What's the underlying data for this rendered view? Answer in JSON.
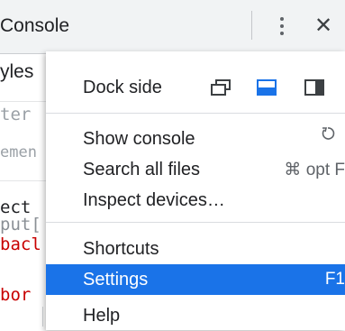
{
  "topbar": {
    "title": "Console",
    "close_glyph": "✕"
  },
  "left_panel": {
    "styles_tab": "yles",
    "filter_placeholder": "ter",
    "element_text": "emen",
    "selector_text": "ect",
    "input_text": "put[",
    "background_prop": "bacl",
    "border_prop": "bor"
  },
  "menu": {
    "dock_side_label": "Dock side",
    "dock_options": [
      "undock-into-separate-window-icon",
      "dock-to-bottom-icon",
      "dock-to-right-icon"
    ],
    "selected_dock": "dock-to-bottom",
    "show_console_label": "Show console",
    "show_console_icon": "refresh-icon",
    "search_all_files_label": "Search all files",
    "search_all_files_shortcut": "⌘ opt F",
    "inspect_devices_label": "Inspect devices…",
    "shortcuts_label": "Shortcuts",
    "settings_label": "Settings",
    "settings_shortcut": "F1",
    "help_label": "Help"
  },
  "colors": {
    "accent": "#1a73e8",
    "css_property": "#c80000"
  }
}
